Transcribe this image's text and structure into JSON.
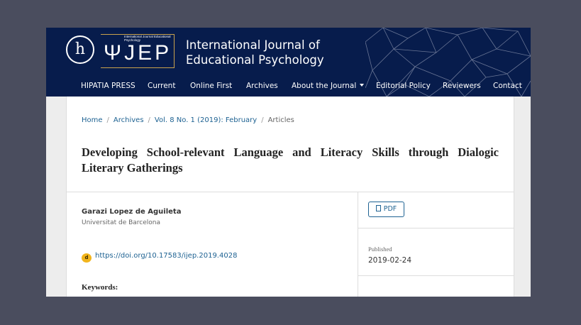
{
  "header": {
    "publisher_logo": "h",
    "journal_logo_small": "International Journal Educational Psychology",
    "journal_logo_text": "ΨJEP",
    "title_line1": "International Journal of",
    "title_line2": "Educational Psychology",
    "brand_bg": "#071c4c",
    "brand_accent": "#c9a24c"
  },
  "nav": {
    "items": [
      {
        "label": "HIPATIA PRESS"
      },
      {
        "label": "Current"
      },
      {
        "label": "Online First"
      },
      {
        "label": "Archives"
      },
      {
        "label": "About the Journal",
        "has_dropdown": true
      },
      {
        "label": "Editorial Policy"
      },
      {
        "label": "Reviewers"
      },
      {
        "label": "Contact"
      }
    ]
  },
  "breadcrumb": {
    "home": "Home",
    "archives": "Archives",
    "issue": "Vol. 8 No. 1 (2019): February",
    "current": "Articles",
    "separator": "/"
  },
  "article": {
    "title": "Developing School-relevant Language and Literacy Skills through Dialogic Literary Gatherings",
    "author": "Garazi Lopez de Aguileta",
    "affiliation": "Universitat de Barcelona",
    "doi_icon": "doi-icon",
    "doi_link": "https://doi.org/10.17583/ijep.2019.4028",
    "keywords_label": "Keywords:"
  },
  "sidebar": {
    "pdf_label": "PDF",
    "published_label": "Published",
    "published_date": "2019-02-24"
  },
  "colors": {
    "link": "#1e6292",
    "page_bg": "#4a4d5e"
  }
}
